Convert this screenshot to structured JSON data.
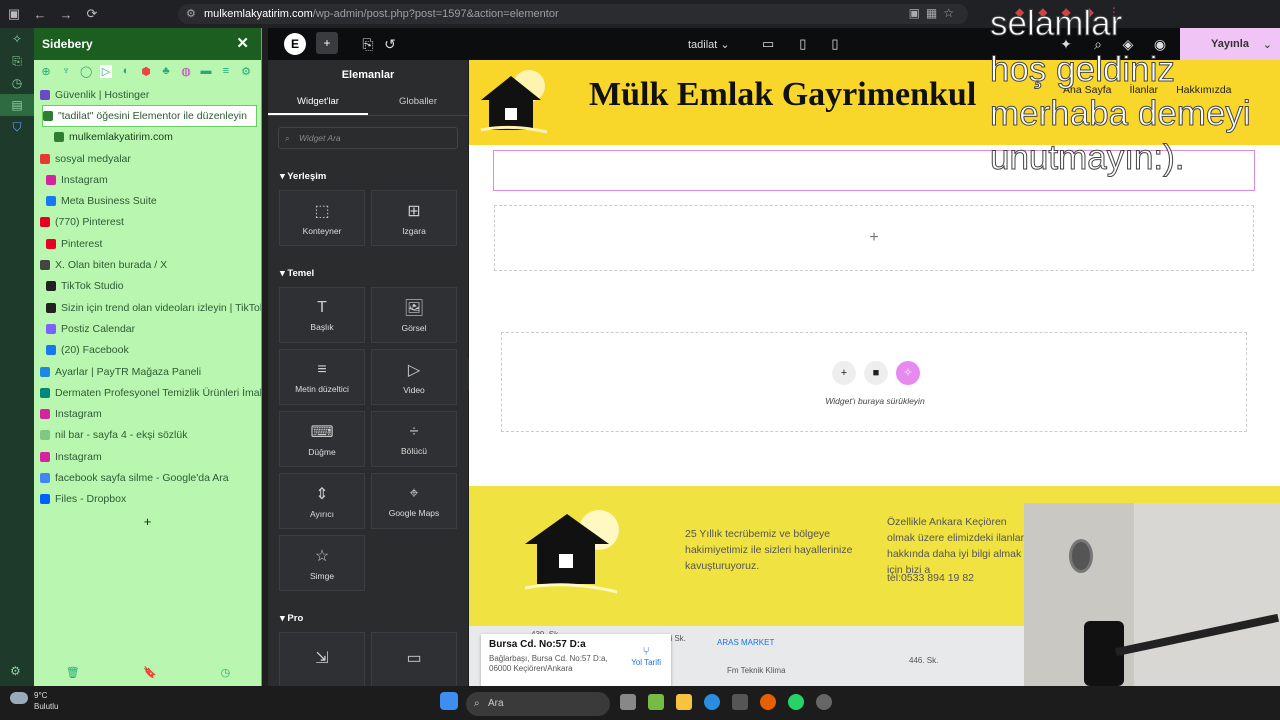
{
  "browser": {
    "url_host": "mulkemlakyatirim.com",
    "url_path": "/wp-admin/post.php?post=1597&action=elementor"
  },
  "sidebery": {
    "title": "Sidebery",
    "tabs": [
      {
        "label": "Güvenlik | Hostinger",
        "color": "#6a4bc7"
      },
      {
        "label": "\"tadilat\" öğesini Elementor ile düzenleyin",
        "color": "#2e7d32",
        "active": true
      },
      {
        "label": "mulkemlakyatirim.com",
        "color": "#2e7d32"
      },
      {
        "label": "sosyal medyalar",
        "color": "#e53935"
      },
      {
        "label": "Instagram",
        "color": "#d6249f"
      },
      {
        "label": "Meta Business Suite",
        "color": "#1877f2"
      },
      {
        "label": "(770) Pinterest",
        "color": "#e60023"
      },
      {
        "label": "Pinterest",
        "color": "#e60023"
      },
      {
        "label": "X. Olan biten burada / X",
        "color": "#444444"
      },
      {
        "label": "TikTok Studio",
        "color": "#222222"
      },
      {
        "label": "Sizin için trend olan videoları izleyin | TikTok",
        "color": "#222222"
      },
      {
        "label": "Postiz Calendar",
        "color": "#7b61ff"
      },
      {
        "label": "(20) Facebook",
        "color": "#1877f2"
      },
      {
        "label": "Ayarlar | PayTR Mağaza Paneli",
        "color": "#1e88e5"
      },
      {
        "label": "Dermaten Profesyonel Temizlik Ürünleri İmalat",
        "color": "#00897b"
      },
      {
        "label": "Instagram",
        "color": "#d6249f"
      },
      {
        "label": "nil bar - sayfa 4 - ekşi sözlük",
        "color": "#81c784"
      },
      {
        "label": "Instagram",
        "color": "#d6249f"
      },
      {
        "label": "facebook sayfa silme - Google'da Ara",
        "color": "#4285f4"
      },
      {
        "label": "Files - Dropbox",
        "color": "#0061ff"
      }
    ],
    "add_label": "+"
  },
  "elementor": {
    "page_name": "tadilat",
    "publish_label": "Yayınla",
    "panel_title": "Elemanlar",
    "tab_widgets": "Widget'lar",
    "tab_globals": "Globaller",
    "search_placeholder": "Widget Ara",
    "section_layout": "Yerleşim",
    "section_basic": "Temel",
    "section_pro": "Pro",
    "layout_widgets": [
      {
        "label": "Konteyner",
        "icon": "⬚"
      },
      {
        "label": "Izgara",
        "icon": "⊞"
      }
    ],
    "basic_widgets": [
      {
        "label": "Başlık",
        "icon": "T"
      },
      {
        "label": "Görsel",
        "icon": "🖼"
      },
      {
        "label": "Metin düzeltici",
        "icon": "≡"
      },
      {
        "label": "Video",
        "icon": "▷"
      },
      {
        "label": "Düğme",
        "icon": "⌨"
      },
      {
        "label": "Bölücü",
        "icon": "÷"
      },
      {
        "label": "Ayırıcı",
        "icon": "⇕"
      },
      {
        "label": "Google Maps",
        "icon": "⌖"
      },
      {
        "label": "Simge",
        "icon": "☆"
      }
    ]
  },
  "site": {
    "title": "Mülk Emlak Gayrimenkul",
    "nav": [
      "Ana Sayfa",
      "İlanlar",
      "Hakkımızda"
    ],
    "drop_hint": "Widget'ı buraya sürükleyin",
    "footer_text1": "25 Yıllık tecrübemiz ve bölgeye hakimiyetimiz ile sizleri hayallerinize kavuşturuyoruz.",
    "footer_text2": "Özellikle Ankara Keçiören olmak üzere elimizdeki ilanlar hakkında daha iyi bilgi almak için bizi a",
    "footer_tel": "tel:0533 894 19 82",
    "map_address": "Bursa Cd. No:57 D:a",
    "map_address_full": "Bağlarbaşı, Bursa Cd. No:57 D:a, 06000 Keçiören/Ankara",
    "map_directions": "Yol Tarifi",
    "map_labels": [
      "439. Sk.",
      "Güneşli Sk.",
      "ARAS MARKET",
      "Fm Teknik Klima",
      "446. Sk."
    ]
  },
  "overlay": {
    "line1": "selamlar",
    "line2": "hoş geldiniz",
    "line3": "merhaba demeyi",
    "line4": "unutmayın:)."
  },
  "taskbar": {
    "temp": "9°C",
    "weather": "Bulutlu",
    "search": "Ara"
  }
}
